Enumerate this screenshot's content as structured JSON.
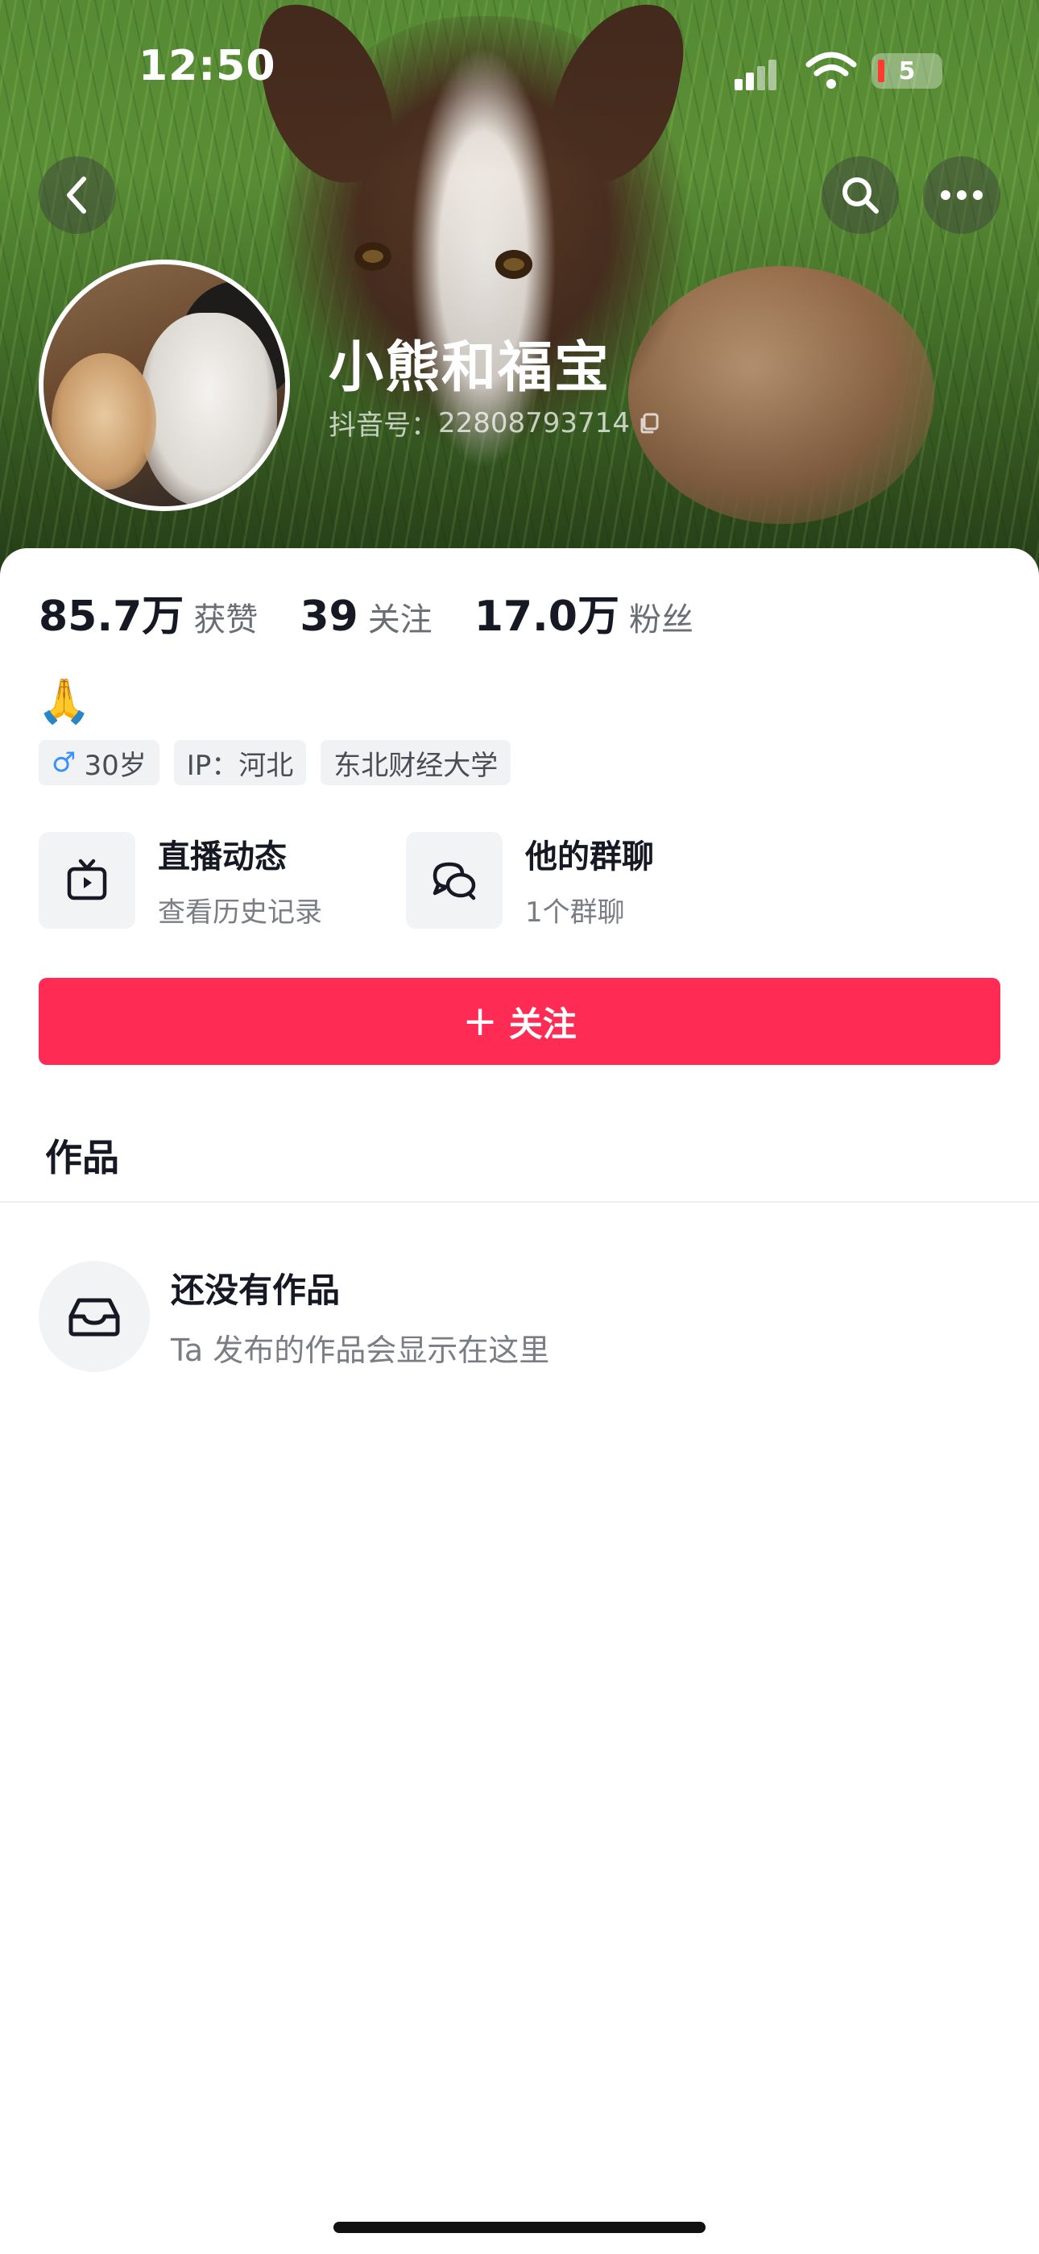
{
  "status_bar": {
    "time": "12:50",
    "battery": "5"
  },
  "profile": {
    "name": "小熊和福宝",
    "id_label": "抖音号：",
    "id_value": "22808793714"
  },
  "stats": [
    {
      "value": "85.7万",
      "label": "获赞"
    },
    {
      "value": "39",
      "label": "关注"
    },
    {
      "value": "17.0万",
      "label": "粉丝"
    }
  ],
  "bio": {
    "emoji": "🙏"
  },
  "tags": {
    "gender_symbol": "♂",
    "age": "30岁",
    "ip": "IP：河北",
    "school": "东北财经大学"
  },
  "features": {
    "live": {
      "title": "直播动态",
      "subtitle": "查看历史记录"
    },
    "group": {
      "title": "他的群聊",
      "subtitle": "1个群聊"
    }
  },
  "follow_button": {
    "icon": "+",
    "label": "关注"
  },
  "tabs": {
    "works": "作品"
  },
  "empty_state": {
    "title": "还没有作品",
    "subtitle": "Ta 发布的作品会显示在这里"
  },
  "colors": {
    "accent": "#fe2c55",
    "male_icon": "#3a90ff",
    "text": "#161823",
    "secondary": "#7b7d85"
  },
  "icons": [
    "back-icon",
    "search-icon",
    "more-icon",
    "copy-icon",
    "tv-icon",
    "chat-icon",
    "inbox-icon"
  ]
}
